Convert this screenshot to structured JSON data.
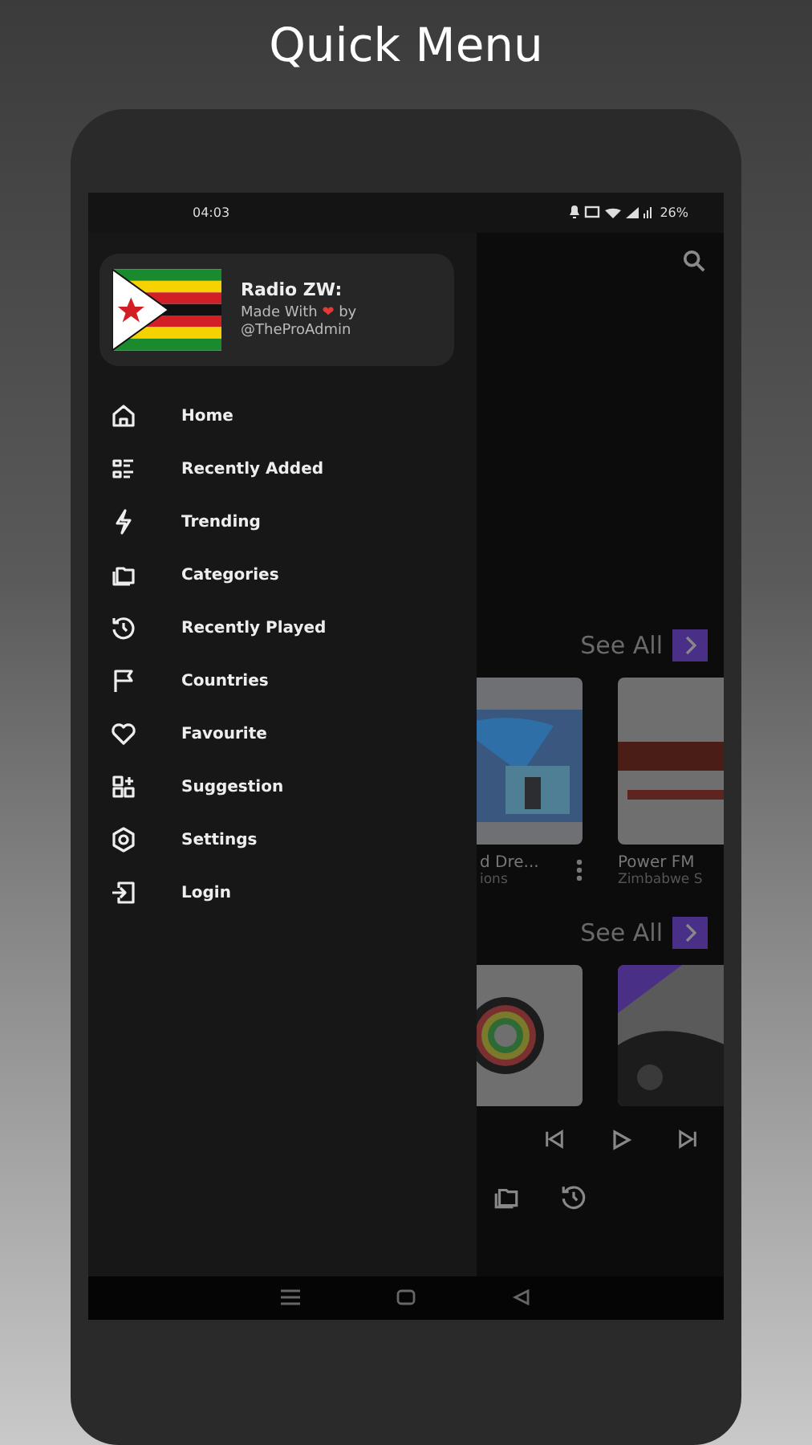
{
  "title": "Quick Menu",
  "status_bar": {
    "time": "04:03",
    "battery": "26%"
  },
  "drawer": {
    "app_name": "Radio ZW:",
    "tagline": "Made With **❤** by",
    "author": "@TheProAdmin",
    "items": [
      {
        "label": "Home"
      },
      {
        "label": "Recently Added"
      },
      {
        "label": "Trending"
      },
      {
        "label": "Categories"
      },
      {
        "label": "Recently Played"
      },
      {
        "label": "Countries"
      },
      {
        "label": "Favourite"
      },
      {
        "label": "Suggestion"
      },
      {
        "label": "Settings"
      },
      {
        "label": "Login"
      }
    ]
  },
  "sections": [
    {
      "see_all": "See All",
      "cards": [
        {
          "title": "d Dre...",
          "subtitle": "ions",
          "menu": true
        },
        {
          "title": "Power FM",
          "subtitle": "Zimbabwe S"
        }
      ]
    },
    {
      "see_all": "See All"
    }
  ]
}
